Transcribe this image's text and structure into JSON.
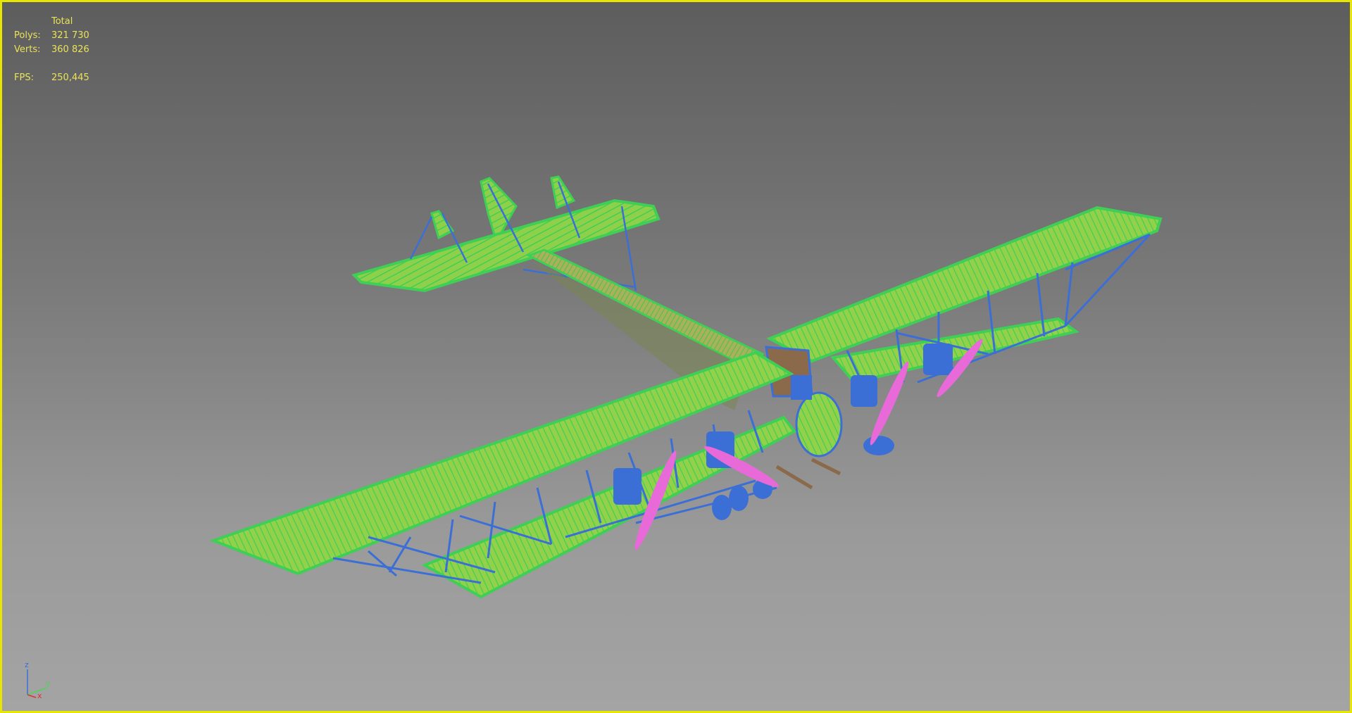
{
  "stats": {
    "header": "Total",
    "polys_label": "Polys:",
    "polys_value": "321 730",
    "verts_label": "Verts:",
    "verts_value": "360 826",
    "fps_label": "FPS:",
    "fps_value": "250,445"
  },
  "axis_gizmo": {
    "z": "z",
    "y": "y",
    "x": "x"
  },
  "colors": {
    "border": "#e8e600",
    "stats_text": "#e9e25a",
    "wing_wire": "#4fd458",
    "wing_inner": "#9ccf4a",
    "strut_blue": "#3b6fd6",
    "propeller_pink": "#e86ad8",
    "fuselage_brown": "#8a6a4a"
  }
}
